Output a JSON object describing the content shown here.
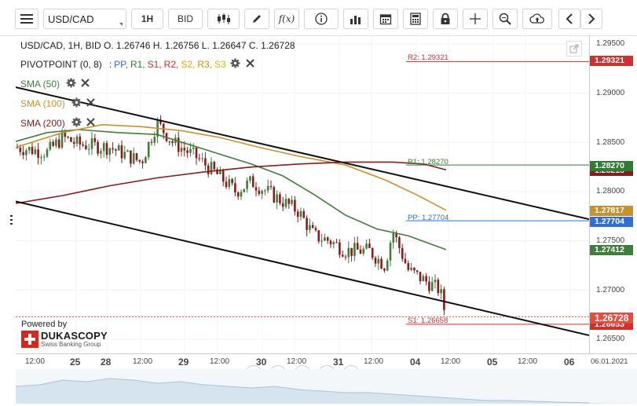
{
  "toolbar": {
    "symbol": "USD/CAD",
    "timeframe": "1H",
    "price_side": "BID",
    "fx_label": "f(x)"
  },
  "legend": {
    "ohlc": "USD/CAD, 1H, BID   O. 1.26746 H. 1.26756 L. 1.26647 C. 1.26728",
    "pivot_title": "PIVOTPOINT (0, 8)",
    "pivot_sep": ":",
    "pivot_items": [
      {
        "label": "PP,",
        "color": "#2f6fdb"
      },
      {
        "label": "R1,",
        "color": "#2e7d32"
      },
      {
        "label": "S1,",
        "color": "#d32f2f"
      },
      {
        "label": "R2,",
        "color": "#d32f2f"
      },
      {
        "label": "S2,",
        "color": "#e0a800"
      },
      {
        "label": "R3,",
        "color": "#d98c00"
      },
      {
        "label": "S3",
        "color": "#e0b800"
      }
    ],
    "sma50": "SMA (50)",
    "sma100": "SMA (100)",
    "sma200": "SMA (200)"
  },
  "pivot_labels": {
    "r2": "R2: 1.29321",
    "r1": "R1: 1.28270",
    "pp": "PP: 1.27704",
    "s1": "S1: 1.26658"
  },
  "price_axis": {
    "ticks": [
      "1.29500",
      "1.29000",
      "1.28500",
      "1.28000",
      "1.27500",
      "1.27000",
      "1.26500"
    ],
    "badges": [
      {
        "text": "1.29321",
        "color": "#d32f2f"
      },
      {
        "text": "1.28270",
        "color": "#2e7d32"
      },
      {
        "text": "1.28218",
        "color": "#8b1a1a"
      },
      {
        "text": "1.27817",
        "color": "#c8922a"
      },
      {
        "text": "1.27704",
        "color": "#2f6fdb"
      },
      {
        "text": "1.27412",
        "color": "#3f7d3a"
      },
      {
        "text": "1.26728",
        "color": "#e84c3d"
      },
      {
        "text": "1.26653",
        "color": "#d32f2f"
      }
    ]
  },
  "time_axis": {
    "labels": [
      "12:00",
      "25",
      "28",
      "12:00",
      "29",
      "12:00",
      "30",
      "12:00",
      "31",
      "12:00",
      "04",
      "12:00",
      "05",
      "12:00",
      "06",
      "06.01.2021"
    ]
  },
  "branding": {
    "powered_by": "Powered by",
    "company": "DUKASCOPY",
    "tagline": "Swiss Banking Group"
  },
  "colors": {
    "sma50": "#3f7d3a",
    "sma100": "#c8922a",
    "sma200": "#8b1a1a",
    "bull": "#3f7d3a",
    "bear": "#8b1a1a",
    "pp": "#2f6fdb",
    "r1": "#2e7d32",
    "r2": "#d32f2f",
    "s1": "#d32f2f"
  },
  "icons": {
    "menu": "hamburger-icon",
    "candles": "candlestick-icon",
    "draw": "pencil-icon",
    "info": "info-icon",
    "volume": "bar-chart-icon",
    "calendar": "calendar-icon",
    "calculator": "calculator-icon",
    "lock": "lock-icon",
    "crosshair": "crosshair-icon",
    "zoom": "zoom-icon",
    "cloud": "cloud-upload-icon",
    "prev": "chevron-left-icon",
    "next": "chevron-right-icon"
  }
}
